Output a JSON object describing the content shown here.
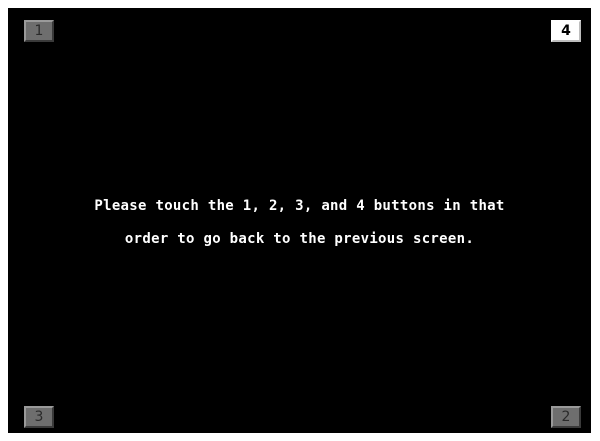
{
  "buttons": {
    "top_left": {
      "label": "1",
      "state": "inactive"
    },
    "top_right": {
      "label": "4",
      "state": "active"
    },
    "bottom_left": {
      "label": "3",
      "state": "inactive"
    },
    "bottom_right": {
      "label": "2",
      "state": "inactive"
    }
  },
  "message": {
    "line1": "Please touch the 1, 2, 3, and 4 buttons in that",
    "line2": "order to go back to the previous screen."
  },
  "colors": {
    "background": "#000000",
    "text": "#ffffff",
    "button_inactive": "#6e6e6e",
    "button_active": "#ffffff"
  }
}
